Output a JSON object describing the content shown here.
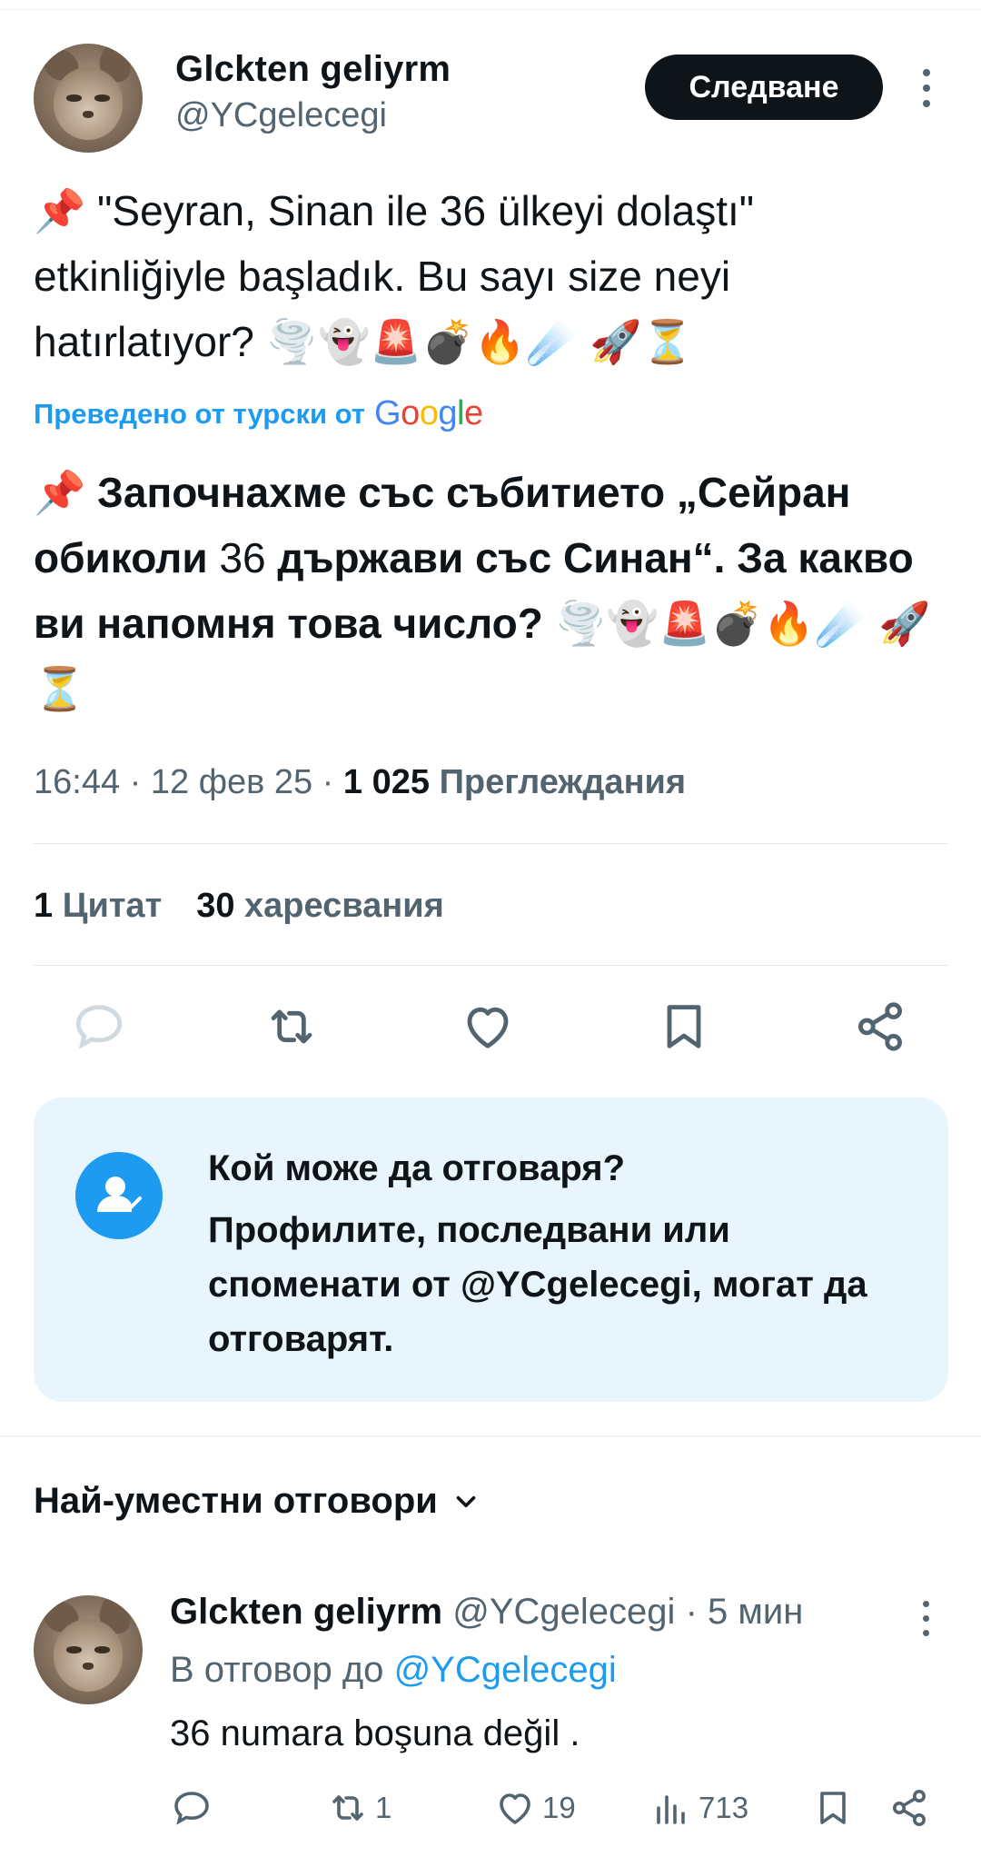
{
  "author": {
    "name": "Glckten geliyrm",
    "handle": "@YCgelecegi"
  },
  "follow_label": "Следване",
  "tweet": {
    "original_text": "📌 \"Seyran, Sinan ile 36 ülkeyi dolaştı\" etkinliğiyle başladık. Bu sayı size neyi hatırlatıyor? 🌪️👻🚨💣🔥☄️  🚀⏳",
    "translated_by_label": "Преведено от турски от",
    "google_label": "Google",
    "translated_text_part1": "📌 Започнахме със събитието „Сейран обиколи ",
    "translated_number": "36",
    "translated_text_part2": " държави със Синан“. За какво ви напомня това число? 🌪️👻🚨💣🔥☄️  🚀⏳",
    "time": "16:44",
    "date": "12 фев 25",
    "views_count": "1 025",
    "views_label": "Преглеждания"
  },
  "stats": {
    "quotes_count": "1",
    "quotes_label": "Цитат",
    "likes_count": "30",
    "likes_label": "харесвания"
  },
  "who_can_reply": {
    "title": "Кой може да отговаря?",
    "body": "Профилите, последвани или споменати от @YCgelecegi, могат да отговарят."
  },
  "sort_label": "Най-уместни отговори",
  "reply": {
    "name": "Glckten geliyrm",
    "handle": "@YCgelecegi",
    "time_ago": "· 5 мин",
    "reply_to_label": "В отговор до",
    "reply_to_handle": "@YCgelecegi",
    "text": "36 numara boşuna değil .",
    "retweets": "1",
    "likes": "19",
    "views": "713"
  },
  "colors": {
    "accent": "#1d9bf0",
    "text": "#0f1419",
    "secondary": "#536471",
    "reply_box_bg": "#e8f5fd"
  },
  "icons": [
    "more-vert-icon",
    "reply-icon",
    "retweet-icon",
    "like-icon",
    "bookmark-icon",
    "share-icon",
    "chevron-down-icon",
    "views-icon",
    "user-check-icon"
  ]
}
